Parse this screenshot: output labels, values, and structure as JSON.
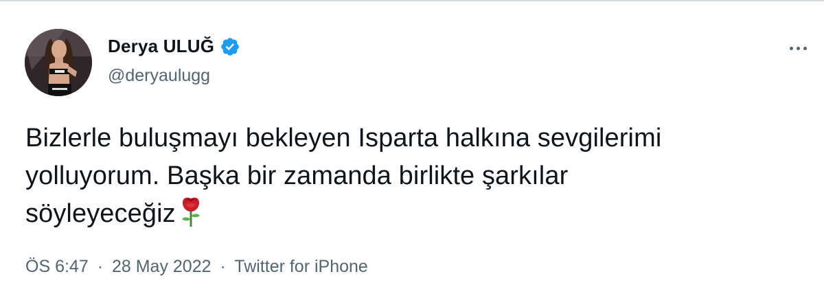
{
  "user": {
    "display_name": "Derya ULUĞ",
    "handle": "@deryaulugg",
    "verified_icon": "verified-badge-icon",
    "avatar": "profile-photo"
  },
  "menu": {
    "icon": "more-options-icon"
  },
  "tweet": {
    "lines": [
      "Bizlerle buluşmayı bekleyen Isparta halkına sevgilerimi",
      "yolluyorum. Başka bir zamanda birlikte şarkılar",
      "söyleyeceğiz"
    ],
    "emoji": "rose-icon"
  },
  "meta": {
    "time": "ÖS 6:47",
    "separator": "·",
    "date": "28 May 2022",
    "source": "Twitter for iPhone"
  },
  "colors": {
    "text": "#0f1419",
    "secondary": "#536471",
    "verified": "#1d9bf0"
  }
}
